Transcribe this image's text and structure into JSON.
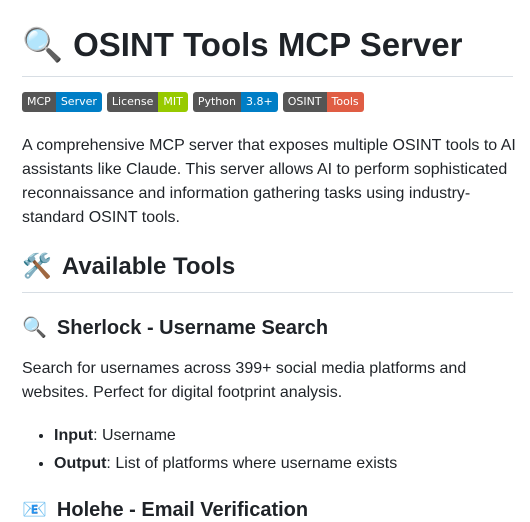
{
  "title": {
    "icon": "🔍",
    "text": "OSINT Tools MCP Server"
  },
  "badges": [
    {
      "key": "MCP",
      "value": "Server",
      "color": "#007ec6"
    },
    {
      "key": "License",
      "value": "MIT",
      "color": "#97ca00"
    },
    {
      "key": "Python",
      "value": "3.8+",
      "color": "#007ec6"
    },
    {
      "key": "OSINT",
      "value": "Tools",
      "color": "#e05d44"
    }
  ],
  "intro": "A comprehensive MCP server that exposes multiple OSINT tools to AI assistants like Claude. This server allows AI to perform sophisticated reconnaissance and information gathering tasks using industry-standard OSINT tools.",
  "available_tools": {
    "icon": "🛠️",
    "text": "Available Tools"
  },
  "sherlock": {
    "icon": "🔍",
    "heading": "Sherlock - Username Search",
    "description": "Search for usernames across 399+ social media platforms and websites. Perfect for digital footprint analysis.",
    "bullets": [
      {
        "label": "Input",
        "text": ": Username"
      },
      {
        "label": "Output",
        "text": ": List of platforms where username exists"
      }
    ]
  },
  "holehe": {
    "icon": "📧",
    "heading": "Holehe - Email Verification"
  }
}
